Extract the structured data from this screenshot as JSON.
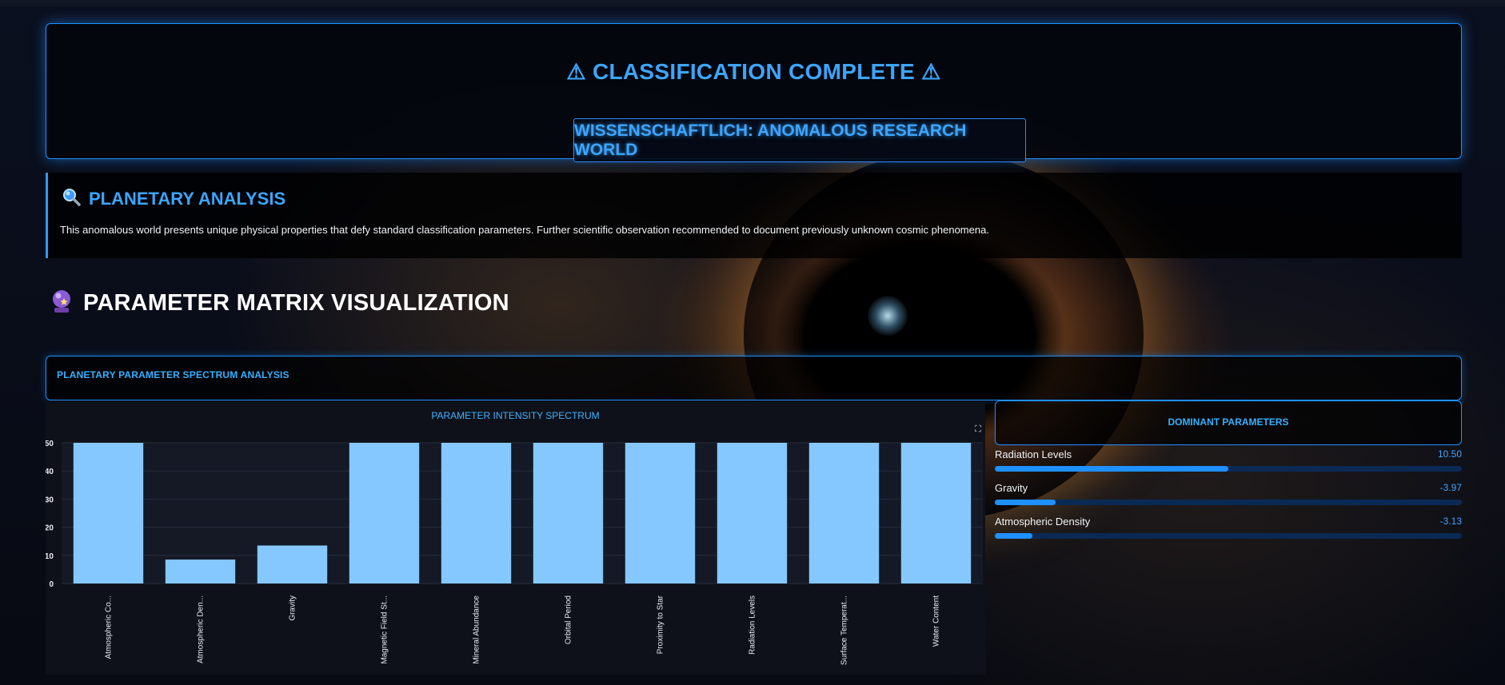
{
  "hero": {
    "warn_icon": "⚠",
    "title": "CLASSIFICATION COMPLETE",
    "classification": "WISSENSCHAFTLICH: ANOMALOUS RESEARCH WORLD"
  },
  "analysis": {
    "icon": "magnifier-icon",
    "heading": "PLANETARY ANALYSIS",
    "description": "This anomalous world presents unique physical properties that defy standard classification parameters. Further scientific observation recommended to document previously unknown cosmic phenomena."
  },
  "matrix": {
    "icon": "crystal-ball-icon",
    "heading": "PARAMETER MATRIX VISUALIZATION"
  },
  "spectrum_header": "PLANETARY PARAMETER SPECTRUM ANALYSIS",
  "chart_title": "PARAMETER INTENSITY SPECTRUM",
  "chart_data": {
    "type": "bar",
    "title": "PARAMETER INTENSITY SPECTRUM",
    "xlabel": "",
    "ylabel": "",
    "categories": [
      "Atmospheric Co...",
      "Atmospheric Den...",
      "Gravity",
      "Magnetic Field St...",
      "Mineral Abundance",
      "Orbital Period",
      "Proximity to Star",
      "Radiation Levels",
      "Surface Temperat...",
      "Water Content"
    ],
    "values": [
      50,
      8.5,
      13.5,
      50,
      50,
      50,
      50,
      50,
      50,
      50
    ],
    "yticks": [
      0,
      10,
      20,
      30,
      40,
      50
    ],
    "ylim": [
      0,
      50
    ],
    "grid": true,
    "color": "#85c8ff"
  },
  "dominant": {
    "heading": "DOMINANT PARAMETERS",
    "items": [
      {
        "name": "Radiation Levels",
        "value": "10.50",
        "level": 0.5
      },
      {
        "name": "Gravity",
        "value": "-3.97",
        "level": 0.13
      },
      {
        "name": "Atmospheric Density",
        "value": "-3.13",
        "level": 0.08
      }
    ]
  },
  "colors": {
    "accent": "#1e90ff",
    "accent_text": "#3da5ff",
    "bar": "#85c8ff",
    "track": "#0a2a55"
  }
}
